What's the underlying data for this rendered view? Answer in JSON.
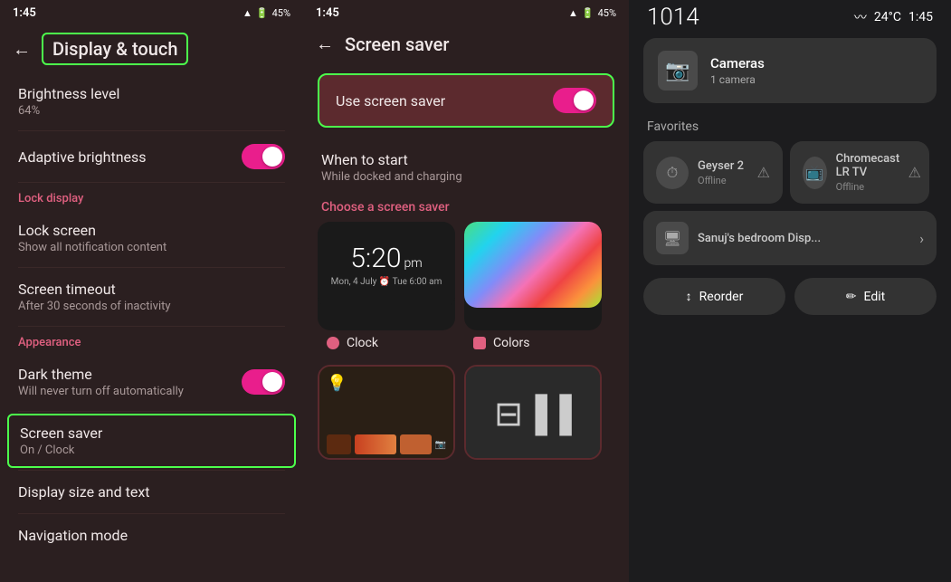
{
  "panel1": {
    "status": {
      "time": "1:45",
      "icons": "📶 🔋 45%"
    },
    "toolbar": {
      "back_label": "←",
      "title": "Display & touch"
    },
    "items": [
      {
        "label": "Brightness level",
        "sublabel": "64%",
        "type": "plain"
      },
      {
        "label": "Adaptive brightness",
        "sublabel": "",
        "type": "toggle",
        "enabled": true
      },
      {
        "section": "Lock display"
      },
      {
        "label": "Lock screen",
        "sublabel": "Show all notification content",
        "type": "plain"
      },
      {
        "label": "Screen timeout",
        "sublabel": "After 30 seconds of inactivity",
        "type": "plain"
      },
      {
        "section": "Appearance"
      },
      {
        "label": "Dark theme",
        "sublabel": "Will never turn off automatically",
        "type": "toggle",
        "enabled": true
      },
      {
        "label": "Screen saver",
        "sublabel": "On / Clock",
        "type": "highlighted"
      },
      {
        "label": "Display size and text",
        "sublabel": "",
        "type": "plain"
      },
      {
        "label": "Navigation mode",
        "sublabel": "",
        "type": "plain"
      }
    ]
  },
  "panel2": {
    "status": {
      "time": "1:45",
      "icons": "📶 🔋 45%"
    },
    "toolbar": {
      "back_label": "←",
      "title": "Screen saver"
    },
    "use_screen_saver_label": "Use screen saver",
    "when_to_start_label": "When to start",
    "when_to_start_sub": "While docked and charging",
    "choose_label": "Choose a screen saver",
    "cards": [
      {
        "id": "clock",
        "label": "Clock",
        "dot": "circle"
      },
      {
        "id": "colors",
        "label": "Colors",
        "dot": "square"
      },
      {
        "id": "photo",
        "label": ""
      },
      {
        "id": "slideshow",
        "label": ""
      }
    ],
    "clock_time": "5:20",
    "clock_ampm": "pm",
    "clock_date": "Mon, 4 July ⏰ Tue 6:00 am"
  },
  "panel3": {
    "number": "1014",
    "temperature": "24°C",
    "time": "1:45",
    "device": {
      "name": "Cameras",
      "sub": "1 camera"
    },
    "favorites_label": "Favorites",
    "favorites": [
      {
        "name": "Geyser 2",
        "sub": "Offline",
        "icon": "⏱"
      },
      {
        "name": "Chromecast LR TV",
        "sub": "Offline",
        "icon": "📺"
      }
    ],
    "sanuj": {
      "name": "Sanuj's bedroom Disp...",
      "icon": "🖥"
    },
    "actions": [
      {
        "id": "reorder",
        "label": "Reorder",
        "icon": "↕"
      },
      {
        "id": "edit",
        "label": "Edit",
        "icon": "✏"
      }
    ]
  }
}
